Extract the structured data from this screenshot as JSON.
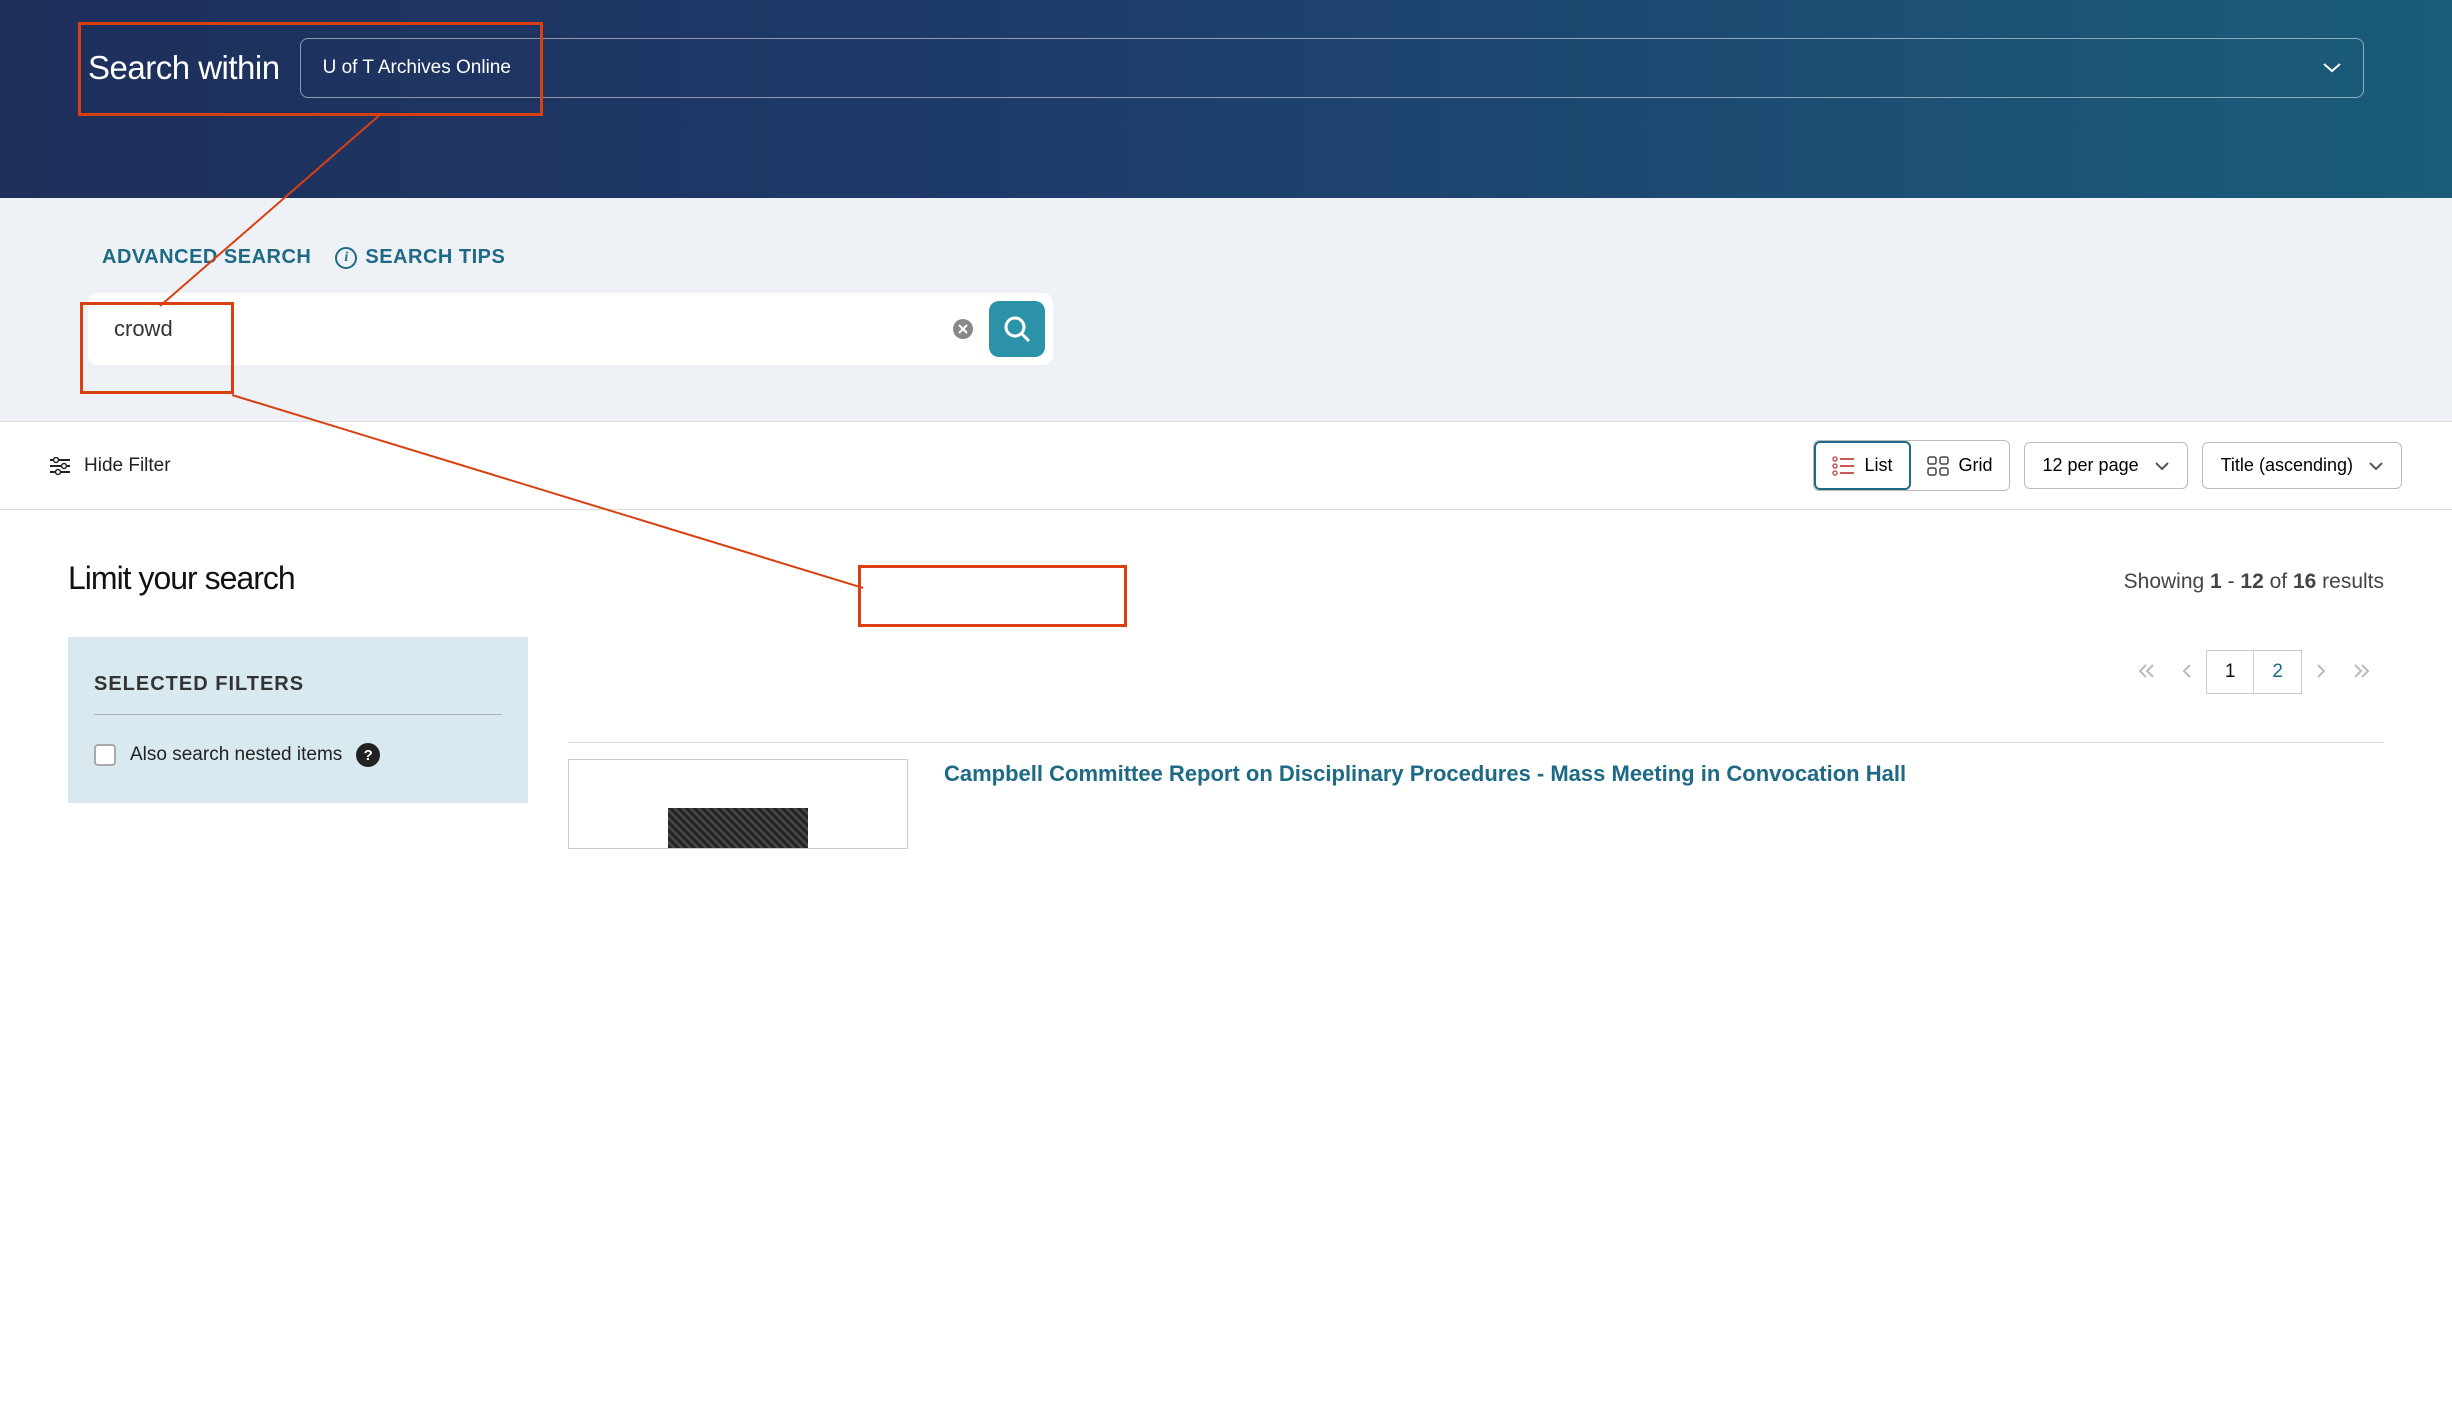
{
  "header": {
    "search_within_label": "Search within",
    "scope_value": "U of T Archives Online"
  },
  "search": {
    "advanced_label": "ADVANCED SEARCH",
    "tips_label": "SEARCH TIPS",
    "query": "crowd"
  },
  "toolbar": {
    "hide_filter_label": "Hide Filter",
    "view_list_label": "List",
    "view_grid_label": "Grid",
    "per_page_label": "12 per page",
    "sort_label": "Title (ascending)"
  },
  "sidebar": {
    "limit_heading": "Limit your search",
    "selected_filters_heading": "SELECTED FILTERS",
    "nested_label": "Also search nested items"
  },
  "results": {
    "showing_prefix": "Showing ",
    "range_from": "1",
    "range_dash": " - ",
    "range_to": "12",
    "of_word": " of ",
    "total": "16",
    "results_word": " results",
    "pages": {
      "current": "1",
      "next": "2"
    },
    "items": [
      {
        "title": "Campbell Committee Report on Disciplinary Procedures - Mass Meeting in Convocation Hall"
      }
    ]
  }
}
